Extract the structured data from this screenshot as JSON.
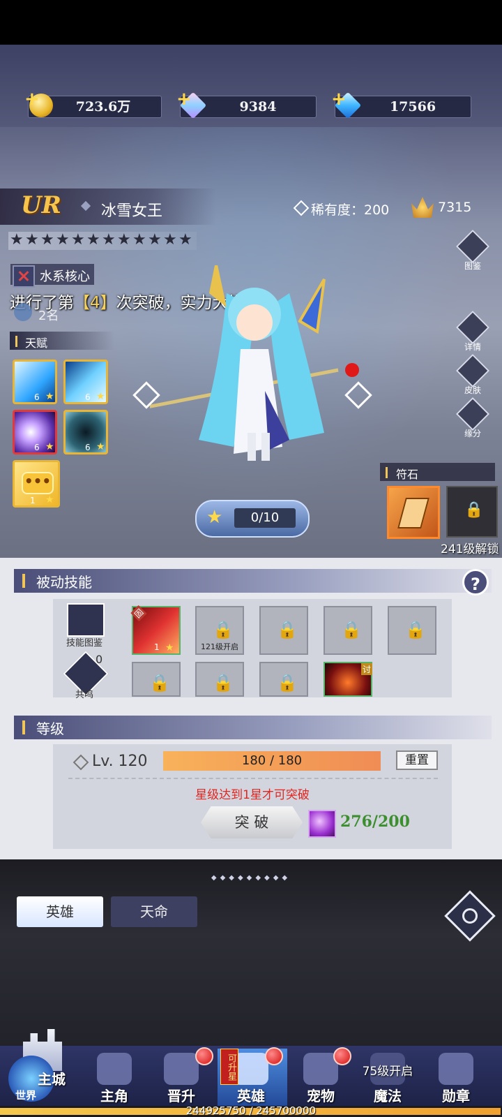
{
  "currency": {
    "gold": "723.6万",
    "crystal": "9384",
    "diamond": "17566"
  },
  "hero": {
    "rarity_badge": "UR",
    "name": "冰雪女王",
    "rarity": "稀有度：200",
    "power": "7315",
    "stars_filled": 0,
    "stars_total": 12,
    "faction": "水系核心",
    "breakthrough_msg_pre": "进行了第",
    "breakthrough_msg_num": "【4】",
    "breakthrough_msg_post": "次突破，实力大增",
    "rank": "2名"
  },
  "talent": {
    "title": "天赋",
    "skills": [
      {
        "level": "6",
        "icon": "ice-spike-icon"
      },
      {
        "level": "6",
        "icon": "ice-blade-icon"
      },
      {
        "level": "6",
        "icon": "purple-slash-icon"
      },
      {
        "level": "6",
        "icon": "dark-vortex-icon"
      },
      {
        "level": "1",
        "icon": "chat-bubble-icon"
      }
    ]
  },
  "side_buttons": [
    {
      "label": "图鉴",
      "icon": "codex-icon"
    },
    {
      "label": "详情",
      "icon": "magnifier-icon"
    },
    {
      "label": "皮肤",
      "icon": "skin-icon"
    },
    {
      "label": "缘分",
      "icon": "heart-icon"
    }
  ],
  "runestone": {
    "title": "符石",
    "unlock": "241级解锁"
  },
  "star_up": {
    "progress": "0/10"
  },
  "passive": {
    "title": "被动技能",
    "codex_label": "技能图鉴",
    "resonance_label": "共鸣",
    "resonance_count": "0",
    "first_skill_level": "1",
    "first_skill_badge": "固",
    "slot_unlock": "121级开启",
    "last_skill_badge": "讨"
  },
  "level": {
    "title": "等级",
    "lv": "Lv. 120",
    "exp": "180 / 180",
    "exp_fraction": 1.0,
    "reset": "重置",
    "requirement": "星级达到1星才可突破",
    "breakthrough_btn": "突 破",
    "cost": "276/200"
  },
  "tabs": {
    "hero": "英雄",
    "fate": "天命"
  },
  "nav": {
    "castle": "主城",
    "world": "世界",
    "items": [
      {
        "label": "主角",
        "dot": false
      },
      {
        "label": "晋升",
        "dot": true
      },
      {
        "label": "英雄",
        "dot": true,
        "badge": "可升星"
      },
      {
        "label": "宠物",
        "dot": true
      },
      {
        "label": "魔法",
        "dot": false,
        "lock": "75级开启"
      },
      {
        "label": "勋章",
        "dot": false
      }
    ]
  },
  "exp_bar": {
    "text": "244925750 / 245700000",
    "fraction": 0.997
  },
  "colors": {
    "accent_gold": "#f7c54b",
    "warning_red": "#e2251f",
    "cost_green": "#3c8f2e"
  }
}
